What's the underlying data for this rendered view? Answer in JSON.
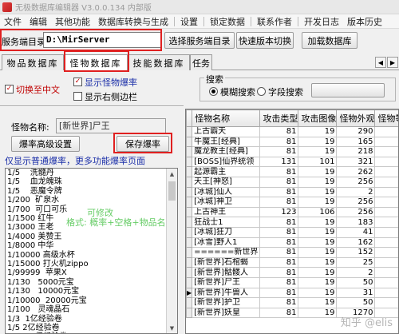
{
  "window": {
    "title": "无极数据库编辑器 V3.0.0.134 内部版"
  },
  "menu": [
    "文件",
    "编辑",
    "其他功能",
    "数据库转换与生成",
    "设置",
    "锁定数据",
    "联系作者",
    "开发日志",
    "版本历史"
  ],
  "toolbar": {
    "dir_label": "服务端目录:",
    "dir_value": "D:\\MirServer",
    "select_dir_button": "选择服务端目录",
    "quick_switch_button": "快速版本切换",
    "load_db_button": "加载数据库"
  },
  "tabs": [
    "物品数据库",
    "怪物数据库",
    "技能数据库",
    "任务"
  ],
  "options": {
    "to_chinese": "切换至中文",
    "show_drop_rate": "显示怪物爆率",
    "show_right_sidebar": "显示右侧边栏",
    "to_chinese_checked": true,
    "show_drop_rate_checked": true,
    "show_right_sidebar_checked": false
  },
  "search": {
    "group_title": "搜索",
    "fuzzy_label": "模糊搜索",
    "field_label": "字段搜索",
    "fuzzy_selected": true
  },
  "monster": {
    "name_label": "怪物名称:",
    "name_value": "[新世界]尸王",
    "advanced_button": "爆率高级设置",
    "save_button": "保存爆率",
    "hint": "仅显示普通爆率，更多功能爆率页面"
  },
  "droplist": {
    "lines": [
      "1/5    洗髓丹",
      "1/5    血龙魄珠",
      "1/5    恶魔令牌",
      "1/200  矿泉水",
      "1/700  可口可乐",
      "1/1500 红牛",
      "1/3000 王老",
      "1/4000 美赞王",
      "1/8000 中华",
      "1/10000 高级水杯",
      "1/15000 打火机zippo",
      "1/99999  苹果X",
      "1/130   5000元宝",
      "1/130   10000元宝",
      "1/10000  20000元宝",
      "1/100   灵魂晶石",
      "1/3  1亿经验卷",
      "1/5 2亿经验卷",
      "1/20  5亿经验卷"
    ],
    "note_line1": "可修改",
    "note_line2": "格式: 概率+空格+物品名称"
  },
  "grid": {
    "headers": [
      "怪物名称",
      "攻击类型",
      "攻击图像",
      "怪物外观",
      "怪物等级"
    ],
    "selected_row_index": 16,
    "rows": [
      [
        "上古霸天",
        "81",
        "19",
        "290"
      ],
      [
        "牛魔王[经典]",
        "81",
        "19",
        "165"
      ],
      [
        "魔龙教主[经典]",
        "81",
        "19",
        "218"
      ],
      [
        "[BOSS]仙界统领",
        "131",
        "101",
        "321"
      ],
      [
        "起源霸主",
        "81",
        "19",
        "262"
      ],
      [
        "天王[神怒]",
        "81",
        "19",
        "256"
      ],
      [
        "[冰城]仙人",
        "81",
        "19",
        "2"
      ],
      [
        "[冰城]神卫",
        "81",
        "19",
        "256"
      ],
      [
        "上古神王",
        "123",
        "106",
        "256"
      ],
      [
        "狂战士1",
        "81",
        "19",
        "183"
      ],
      [
        "[冰城]狂刀",
        "81",
        "19",
        "41"
      ],
      [
        "[冰雪]野人1",
        "81",
        "19",
        "162"
      ],
      [
        "======新世界",
        "81",
        "19",
        "152"
      ],
      [
        "[新世界]石棺蝎",
        "81",
        "19",
        "25"
      ],
      [
        "[新世界]骷髅人",
        "81",
        "19",
        "2"
      ],
      [
        "[新世界]尸王",
        "81",
        "19",
        "50"
      ],
      [
        "[新世界]牛兽人",
        "81",
        "19",
        "31"
      ],
      [
        "[新世界]护卫",
        "81",
        "19",
        "50"
      ],
      [
        "[新世界]妖皇",
        "81",
        "19",
        "1270"
      ]
    ]
  },
  "watermark": "知乎 @elis"
}
